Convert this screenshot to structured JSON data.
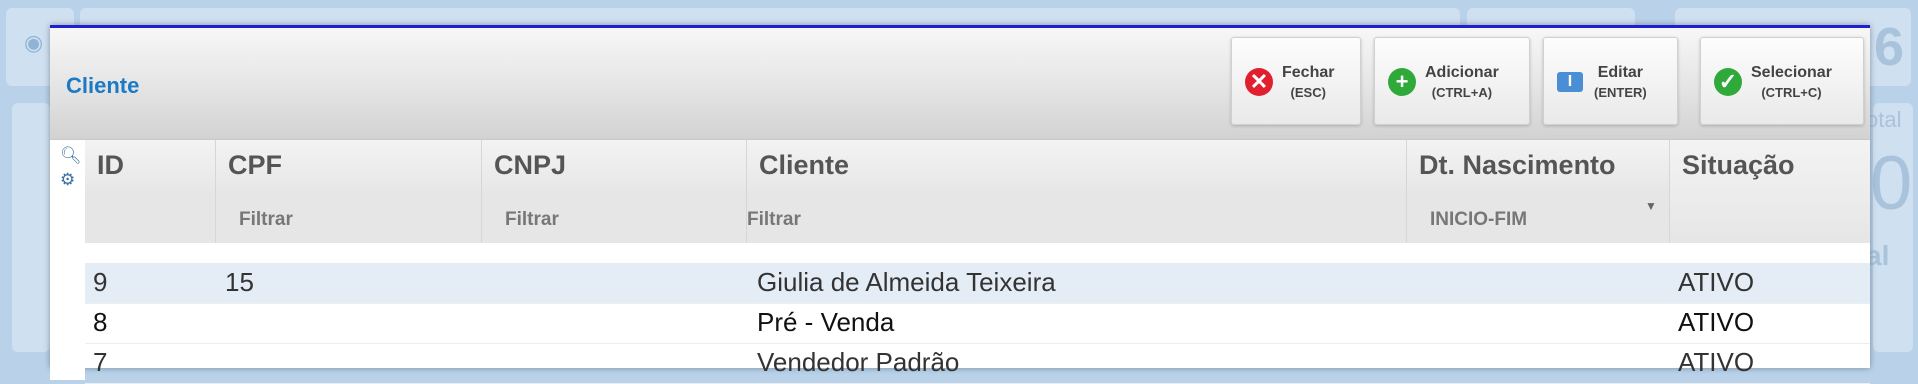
{
  "background": {
    "digit_top": "6",
    "digit_mid": "0",
    "text_right_a": "otal",
    "text_right_b": "al"
  },
  "modal": {
    "title": "Cliente"
  },
  "toolbar": [
    {
      "label": "Fechar",
      "shortcut": "(ESC)",
      "icon": "close-icon",
      "color": "#e0202f"
    },
    {
      "label": "Adicionar",
      "shortcut": "(CTRL+A)",
      "icon": "plus-icon",
      "color": "#2faa3a"
    },
    {
      "label": "Editar",
      "shortcut": "(ENTER)",
      "icon": "edit-icon",
      "color": "#4a8fd6"
    },
    {
      "label": "Selecionar",
      "shortcut": "(CTRL+C)",
      "icon": "check-icon",
      "color": "#2faa3a"
    }
  ],
  "grid": {
    "columns": [
      "ID",
      "CPF",
      "CNPJ",
      "Cliente",
      "Dt. Nascimento",
      "Situação"
    ],
    "filters": [
      "",
      "Filtrar",
      "Filtrar",
      "Filtrar",
      "INICIO-FIM",
      ""
    ],
    "rows": [
      {
        "id": "9",
        "cpf": "15",
        "cnpj": "",
        "cliente": "Giulia de Almeida Teixeira",
        "nasc": "",
        "situacao": "ATIVO"
      },
      {
        "id": "8",
        "cpf": "",
        "cnpj": "",
        "cliente": "Pré - Venda",
        "nasc": "",
        "situacao": "ATIVO"
      },
      {
        "id": "7",
        "cpf": "",
        "cnpj": "",
        "cliente": "Vendedor Padrão",
        "nasc": "",
        "situacao": "ATIVO"
      }
    ]
  }
}
